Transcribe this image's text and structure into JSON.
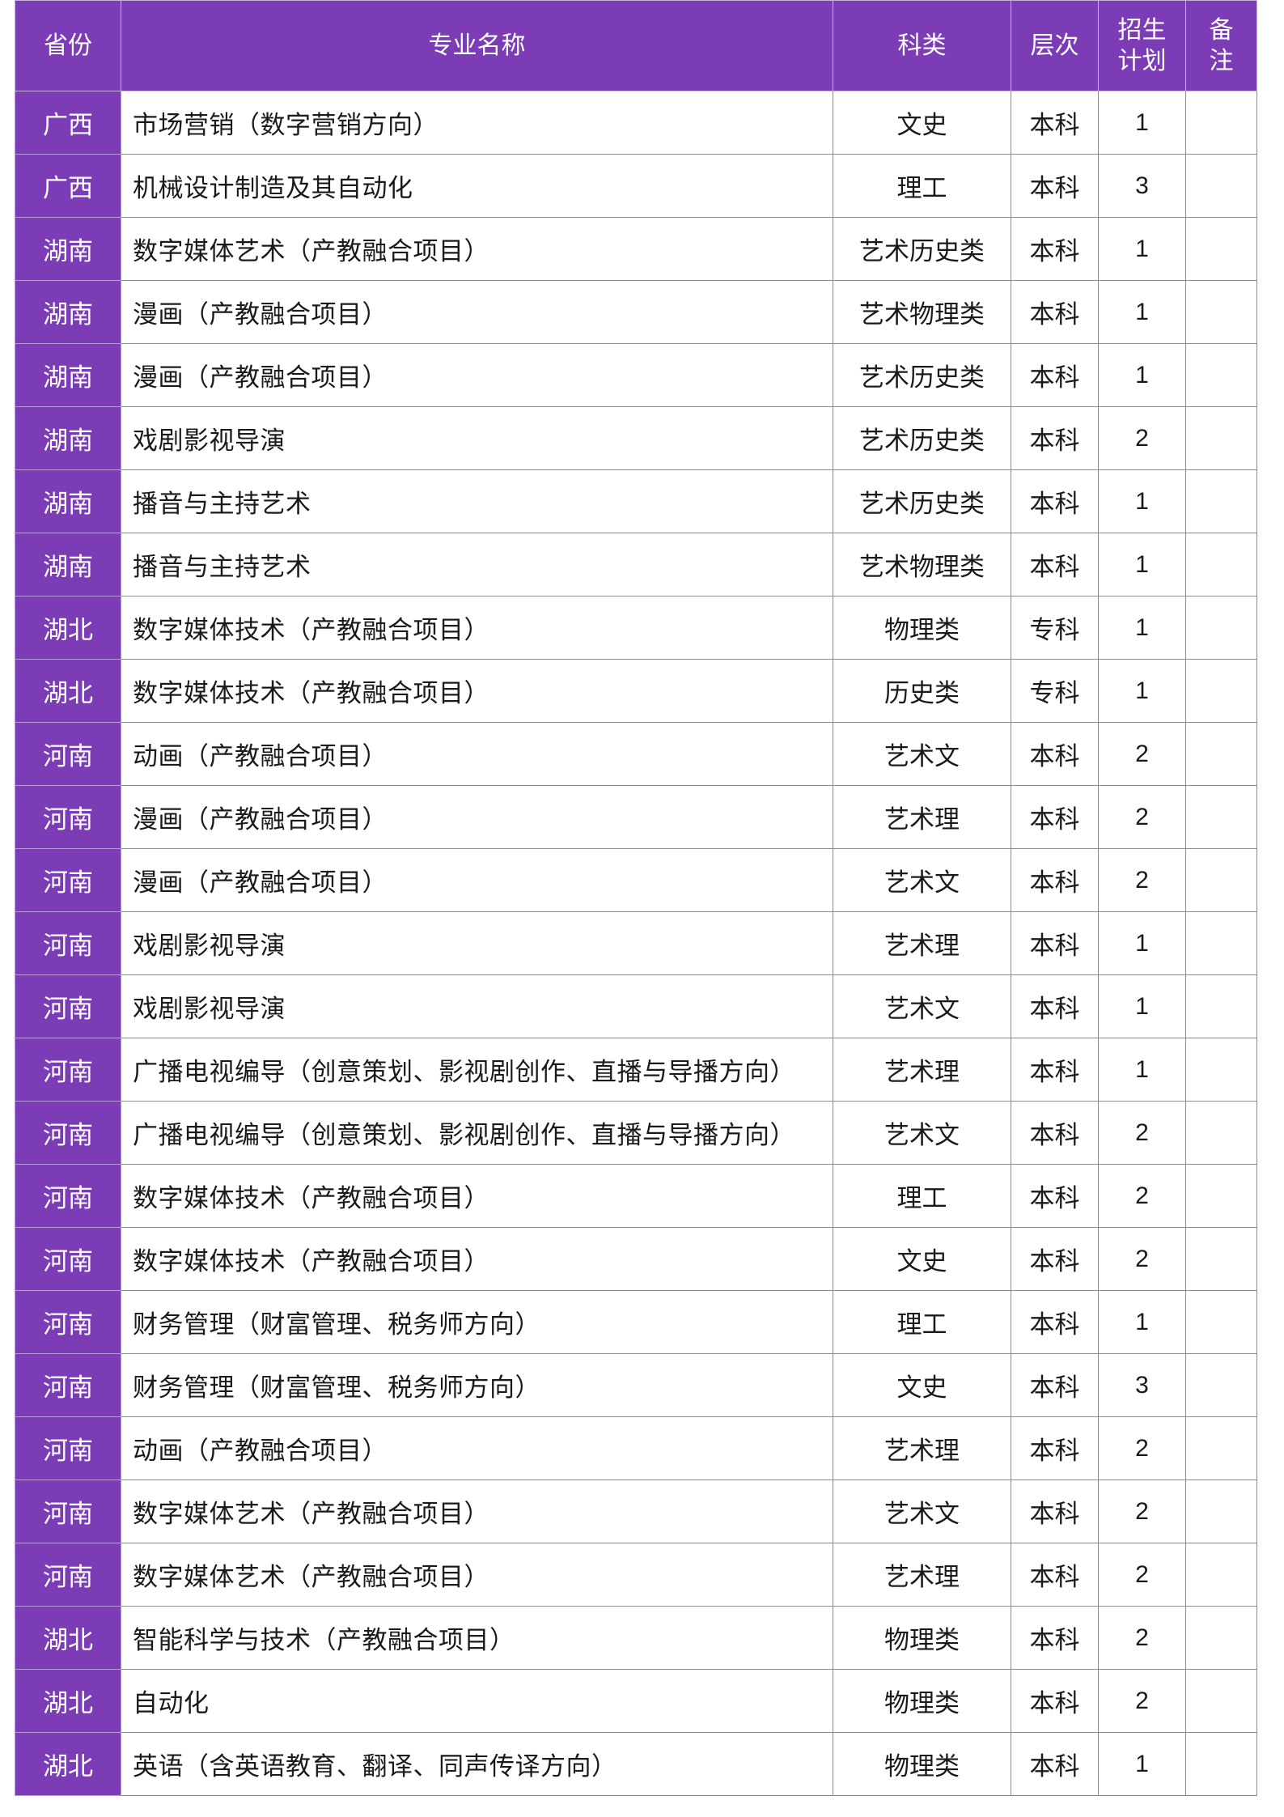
{
  "headers": {
    "province": "省份",
    "major": "专业名称",
    "category": "科类",
    "level": "层次",
    "plan_line1": "招生",
    "plan_line2": "计划",
    "note_line1": "备",
    "note_line2": "注"
  },
  "colors": {
    "header_bg": "#7b3cb5",
    "header_text": "#ffffff",
    "grid": "#8a8a8a"
  },
  "rows": [
    {
      "province": "广西",
      "major": "市场营销（数字营销方向）",
      "category": "文史",
      "level": "本科",
      "plan": "1",
      "note": ""
    },
    {
      "province": "广西",
      "major": "机械设计制造及其自动化",
      "category": "理工",
      "level": "本科",
      "plan": "3",
      "note": ""
    },
    {
      "province": "湖南",
      "major": "数字媒体艺术（产教融合项目）",
      "category": "艺术历史类",
      "level": "本科",
      "plan": "1",
      "note": ""
    },
    {
      "province": "湖南",
      "major": "漫画（产教融合项目）",
      "category": "艺术物理类",
      "level": "本科",
      "plan": "1",
      "note": ""
    },
    {
      "province": "湖南",
      "major": "漫画（产教融合项目）",
      "category": "艺术历史类",
      "level": "本科",
      "plan": "1",
      "note": ""
    },
    {
      "province": "湖南",
      "major": "戏剧影视导演",
      "category": "艺术历史类",
      "level": "本科",
      "plan": "2",
      "note": ""
    },
    {
      "province": "湖南",
      "major": "播音与主持艺术",
      "category": "艺术历史类",
      "level": "本科",
      "plan": "1",
      "note": ""
    },
    {
      "province": "湖南",
      "major": "播音与主持艺术",
      "category": "艺术物理类",
      "level": "本科",
      "plan": "1",
      "note": ""
    },
    {
      "province": "湖北",
      "major": "数字媒体技术（产教融合项目）",
      "category": "物理类",
      "level": "专科",
      "plan": "1",
      "note": ""
    },
    {
      "province": "湖北",
      "major": "数字媒体技术（产教融合项目）",
      "category": "历史类",
      "level": "专科",
      "plan": "1",
      "note": ""
    },
    {
      "province": "河南",
      "major": "动画（产教融合项目）",
      "category": "艺术文",
      "level": "本科",
      "plan": "2",
      "note": ""
    },
    {
      "province": "河南",
      "major": "漫画（产教融合项目）",
      "category": "艺术理",
      "level": "本科",
      "plan": "2",
      "note": ""
    },
    {
      "province": "河南",
      "major": "漫画（产教融合项目）",
      "category": "艺术文",
      "level": "本科",
      "plan": "2",
      "note": ""
    },
    {
      "province": "河南",
      "major": "戏剧影视导演",
      "category": "艺术理",
      "level": "本科",
      "plan": "1",
      "note": ""
    },
    {
      "province": "河南",
      "major": "戏剧影视导演",
      "category": "艺术文",
      "level": "本科",
      "plan": "1",
      "note": ""
    },
    {
      "province": "河南",
      "major": "广播电视编导（创意策划、影视剧创作、直播与导播方向）",
      "category": "艺术理",
      "level": "本科",
      "plan": "1",
      "note": ""
    },
    {
      "province": "河南",
      "major": "广播电视编导（创意策划、影视剧创作、直播与导播方向）",
      "category": "艺术文",
      "level": "本科",
      "plan": "2",
      "note": ""
    },
    {
      "province": "河南",
      "major": "数字媒体技术（产教融合项目）",
      "category": "理工",
      "level": "本科",
      "plan": "2",
      "note": ""
    },
    {
      "province": "河南",
      "major": "数字媒体技术（产教融合项目）",
      "category": "文史",
      "level": "本科",
      "plan": "2",
      "note": ""
    },
    {
      "province": "河南",
      "major": "财务管理（财富管理、税务师方向）",
      "category": "理工",
      "level": "本科",
      "plan": "1",
      "note": ""
    },
    {
      "province": "河南",
      "major": "财务管理（财富管理、税务师方向）",
      "category": "文史",
      "level": "本科",
      "plan": "3",
      "note": ""
    },
    {
      "province": "河南",
      "major": "动画（产教融合项目）",
      "category": "艺术理",
      "level": "本科",
      "plan": "2",
      "note": ""
    },
    {
      "province": "河南",
      "major": "数字媒体艺术（产教融合项目）",
      "category": "艺术文",
      "level": "本科",
      "plan": "2",
      "note": ""
    },
    {
      "province": "河南",
      "major": "数字媒体艺术（产教融合项目）",
      "category": "艺术理",
      "level": "本科",
      "plan": "2",
      "note": ""
    },
    {
      "province": "湖北",
      "major": "智能科学与技术（产教融合项目）",
      "category": "物理类",
      "level": "本科",
      "plan": "2",
      "note": ""
    },
    {
      "province": "湖北",
      "major": "自动化",
      "category": "物理类",
      "level": "本科",
      "plan": "2",
      "note": ""
    },
    {
      "province": "湖北",
      "major": "英语（含英语教育、翻译、同声传译方向）",
      "category": "物理类",
      "level": "本科",
      "plan": "1",
      "note": ""
    }
  ]
}
